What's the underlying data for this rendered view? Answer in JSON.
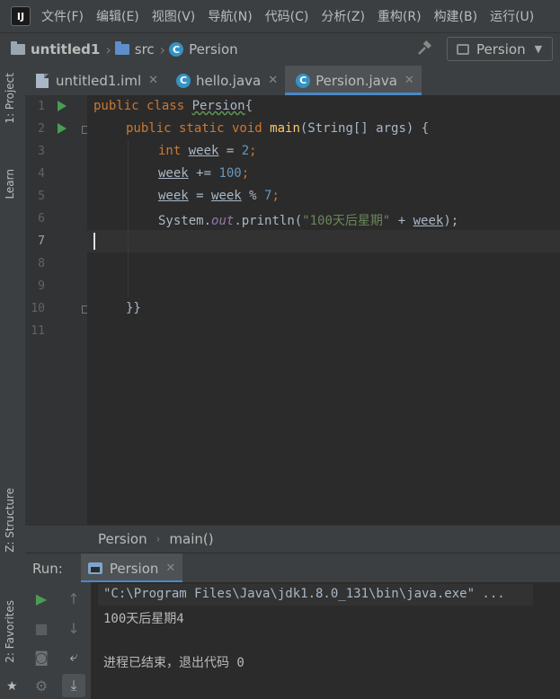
{
  "menu": {
    "logo": "IJ",
    "items": [
      "文件(F)",
      "编辑(E)",
      "视图(V)",
      "导航(N)",
      "代码(C)",
      "分析(Z)",
      "重构(R)",
      "构建(B)",
      "运行(U)"
    ]
  },
  "navbar": {
    "project": "untitled1",
    "folder": "src",
    "file": "Persion",
    "run_config": "Persion"
  },
  "left_tools": {
    "project": "1: Project",
    "learn": "Learn",
    "structure": "Z: Structure",
    "favorites": "2: Favorites"
  },
  "tabs": [
    {
      "label": "untitled1.iml",
      "icon": "module-file-icon"
    },
    {
      "label": "hello.java",
      "icon": "class-icon"
    },
    {
      "label": "Persion.java",
      "icon": "class-icon",
      "active": true
    }
  ],
  "editor": {
    "line_numbers": [
      "1",
      "2",
      "3",
      "4",
      "5",
      "6",
      "7",
      "8",
      "9",
      "10",
      "11"
    ],
    "code": {
      "l1_kw": "public class ",
      "l1_cls": "Persion",
      "l1_brace": "{",
      "l2_kw": "public static void ",
      "l2_fn": "main",
      "l2_rest": "(String[] args) {",
      "l3_kw": "int ",
      "l3_var": "week",
      "l3_eq": " = ",
      "l3_num": "2",
      "l3_semi": ";",
      "l4_var": "week",
      "l4_op": " += ",
      "l4_num": "100",
      "l4_semi": ";",
      "l5_var": "week",
      "l5_op": " = ",
      "l5_var2": "week",
      "l5_op2": " % ",
      "l5_num": "7",
      "l5_semi": ";",
      "l6_a": "System.",
      "l6_out": "out",
      "l6_b": ".println(",
      "l6_str": "\"100天后星期\"",
      "l6_c": " + ",
      "l6_var": "week",
      "l6_d": ");",
      "l10": "}}"
    },
    "breadcrumb": [
      "Persion",
      "main()"
    ]
  },
  "run": {
    "label": "Run:",
    "tab": "Persion",
    "console": [
      "\"C:\\Program Files\\Java\\jdk1.8.0_131\\bin\\java.exe\" ...",
      "100天后星期4",
      "",
      "进程已结束，退出代码 0"
    ]
  },
  "colors": {
    "background": "#2b2b2b",
    "keyword": "#cc7832",
    "function": "#ffc66d",
    "number": "#6897bb",
    "string": "#6a8759",
    "static_field": "#9876aa",
    "accent": "#4a88c7",
    "run_green": "#499c54"
  }
}
